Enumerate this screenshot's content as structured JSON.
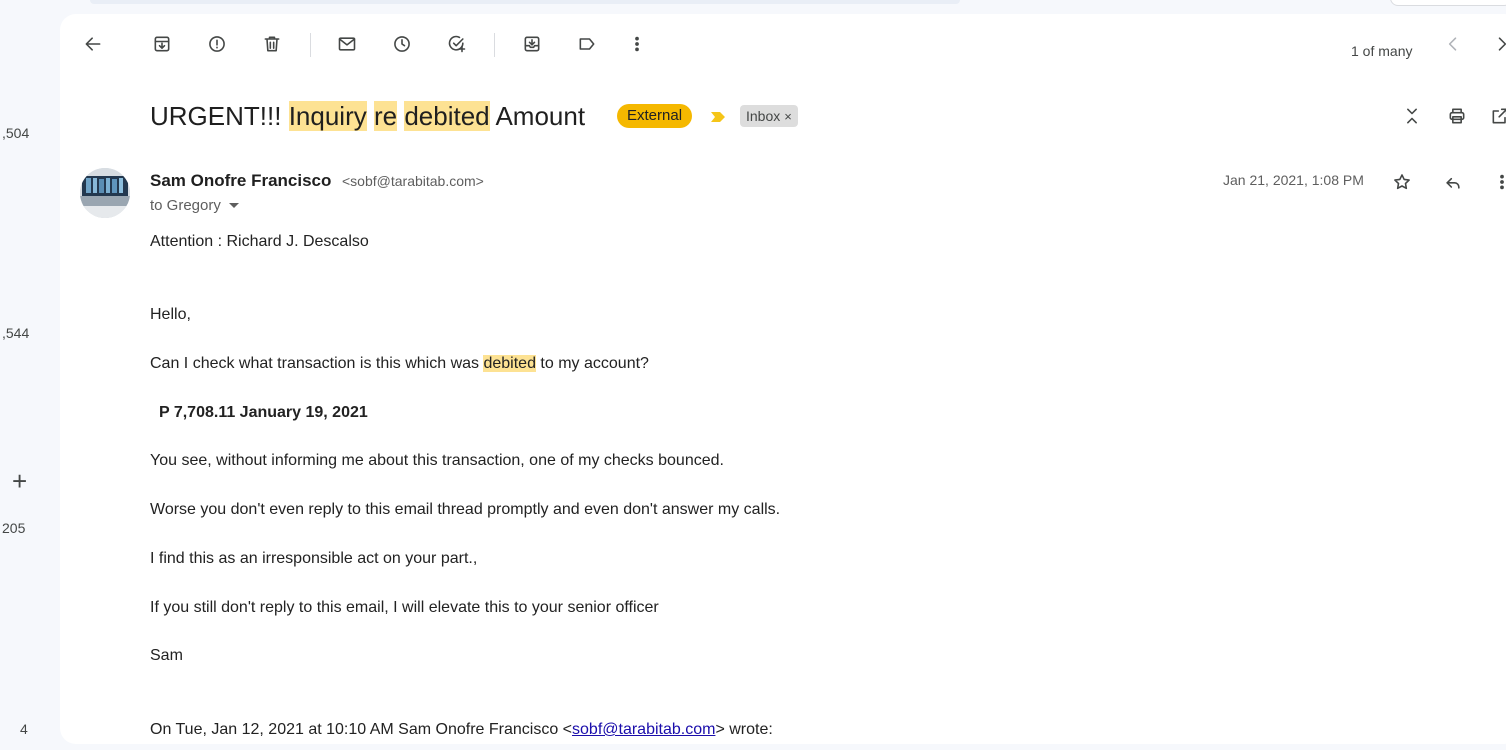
{
  "left_rail": {
    "counts": [
      ",504",
      ",544",
      "205",
      "4"
    ],
    "plus_label": "+"
  },
  "toolbar": {
    "icons": [
      "back-arrow-icon",
      "archive-icon",
      "report-spam-icon",
      "delete-icon",
      "mark-unread-icon",
      "snooze-icon",
      "add-task-icon",
      "move-to-icon",
      "label-icon",
      "more-vert-icon"
    ],
    "pager_text": "1 of many"
  },
  "subject": {
    "parts": [
      "URGENT!!!",
      "Inquiry",
      "re",
      "debited",
      "Amount"
    ],
    "label_external": "External",
    "label_inbox": "Inbox",
    "label_inbox_remove": "×"
  },
  "message": {
    "sender_name": "Sam Onofre Francisco",
    "sender_email": "<sobf@tarabitab.com>",
    "to_line": "to Gregory",
    "date": "Jan 21, 2021, 1:08 PM",
    "attention": "Attention :  Richard J. Descalso",
    "greeting": "Hello,",
    "line1_pre": "Can I check what transaction is this which was ",
    "line1_hl": "debited",
    "line1_post": " to my account?",
    "amount": "P 7,708.11 January 19, 2021",
    "line2": "You see, without informing  me  about this transaction, one of my checks bounced.",
    "line3": "Worse you don't even reply to this email thread promptly and even don't answer my calls.",
    "line4": "I find this as an irresponsible act on your part.,",
    "line5": "If you still don't reply to this email, I will elevate this to your senior officer",
    "signature": "Sam",
    "quote_pre": "On Tue, Jan 12, 2021 at 10:10 AM Sam Onofre Francisco <",
    "quote_link": "sobf@tarabitab.com",
    "quote_post": "> wrote:"
  },
  "colors": {
    "highlight": "#fde293",
    "external_label": "#f5b800",
    "inbox_label": "#dddddd",
    "link": "#1a0dab"
  }
}
